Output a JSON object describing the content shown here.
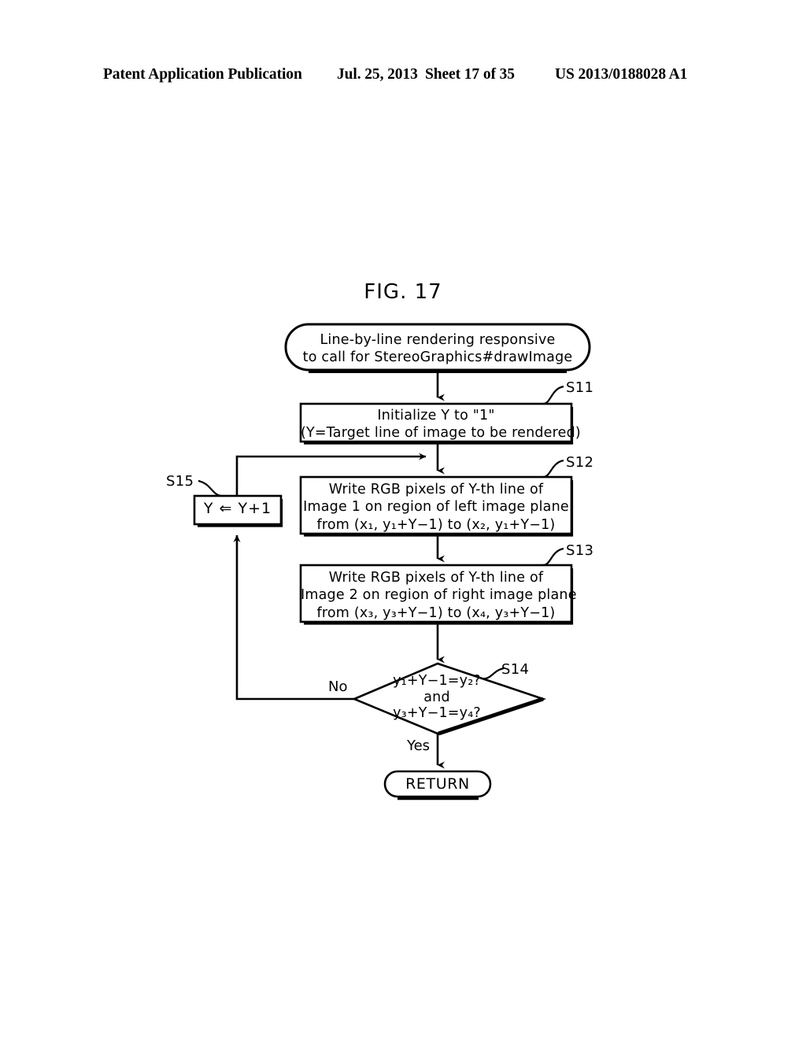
{
  "header": {
    "left": "Patent Application Publication",
    "date": "Jul. 25, 2013",
    "sheet": "Sheet 17 of 35",
    "number": "US 2013/0188028 A1"
  },
  "figure": {
    "title": "FIG. 17"
  },
  "flowchart": {
    "start": {
      "label": "Line-by-line rendering responsive\nto call for StereoGraphics#drawImage",
      "shape": "terminator"
    },
    "steps": [
      {
        "id": "S11",
        "label": "Initialize Y to \"1\"\n(Y=Target line of image to be rendered)",
        "shape": "process"
      },
      {
        "id": "S12",
        "label": "Write RGB pixels of Y-th line of\nImage 1 on region of left image plane\nfrom (x₁, y₁+Y−1) to (x₂, y₁+Y−1)",
        "shape": "process"
      },
      {
        "id": "S13",
        "label": "Write RGB pixels of Y-th line of\nImage 2 on region of right image plane\nfrom (x₃, y₃+Y−1) to (x₄, y₃+Y−1)",
        "shape": "process"
      },
      {
        "id": "S14",
        "label": "y₁+Y−1=y₂?\nand\ny₃+Y−1=y₄?",
        "shape": "decision"
      },
      {
        "id": "S15",
        "label": "Y ⇐ Y+1",
        "shape": "process"
      }
    ],
    "branches": {
      "no": "No",
      "yes": "Yes"
    },
    "end": {
      "label": "RETURN",
      "shape": "terminator"
    },
    "colors": {
      "stroke": "#000000",
      "fill": "#ffffff",
      "text": "#000000"
    }
  }
}
